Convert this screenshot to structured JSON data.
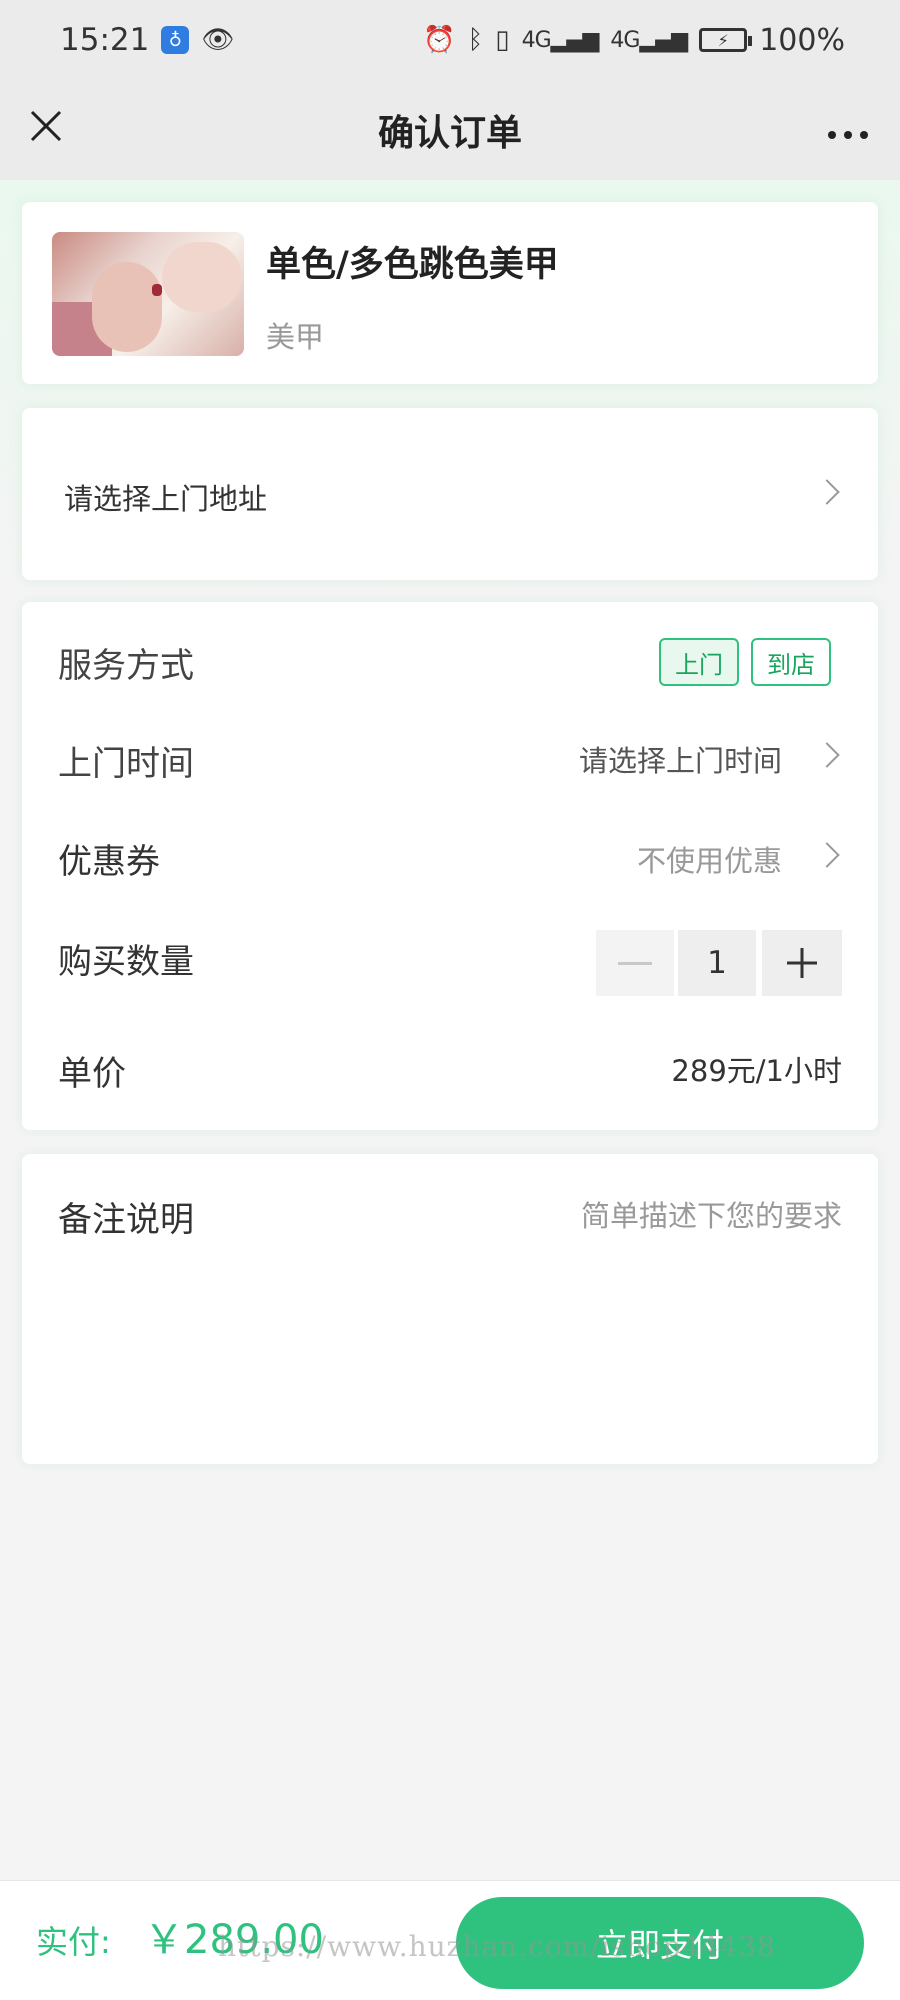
{
  "status_bar": {
    "time": "15:21",
    "battery": "100%",
    "signal_1": "4G",
    "signal_2": "4G"
  },
  "nav": {
    "title": "确认订单"
  },
  "product": {
    "title": "单色/多色跳色美甲",
    "category": "美甲"
  },
  "address": {
    "prompt": "请选择上门地址"
  },
  "details": {
    "service_label": "服务方式",
    "service_options": [
      "上门",
      "到店"
    ],
    "time_label": "上门时间",
    "time_value": "请选择上门时间",
    "coupon_label": "优惠券",
    "coupon_value": "不使用优惠",
    "quantity_label": "购买数量",
    "quantity": "1",
    "price_label": "单价",
    "price_value": "289元/1小时"
  },
  "remark": {
    "label": "备注说明",
    "placeholder": "简单描述下您的要求"
  },
  "footer": {
    "pay_label": "实付:",
    "amount": "￥289.00",
    "pay_button": "立即支付",
    "watermark": "https://www.huzhan.com/ishop44438"
  },
  "colors": {
    "accent": "#2ec27e",
    "background": "#f4f4f4"
  }
}
